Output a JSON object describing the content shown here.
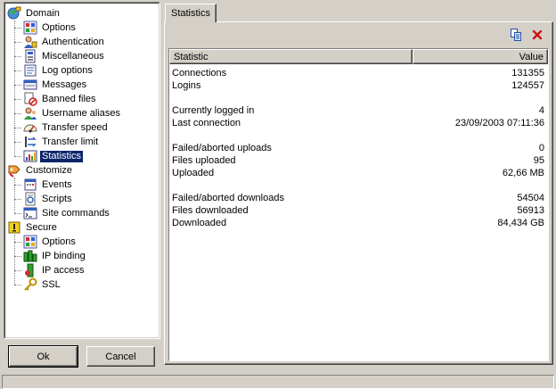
{
  "tree": {
    "items": [
      {
        "label": "Domain",
        "icon": "domain-icon",
        "level": 0
      },
      {
        "label": "Options",
        "icon": "options-icon",
        "level": 1
      },
      {
        "label": "Authentication",
        "icon": "authentication-icon",
        "level": 1
      },
      {
        "label": "Miscellaneous",
        "icon": "miscellaneous-icon",
        "level": 1
      },
      {
        "label": "Log options",
        "icon": "log-options-icon",
        "level": 1
      },
      {
        "label": "Messages",
        "icon": "messages-icon",
        "level": 1
      },
      {
        "label": "Banned files",
        "icon": "banned-files-icon",
        "level": 1
      },
      {
        "label": "Username aliases",
        "icon": "username-aliases-icon",
        "level": 1
      },
      {
        "label": "Transfer speed",
        "icon": "transfer-speed-icon",
        "level": 1
      },
      {
        "label": "Transfer limit",
        "icon": "transfer-limit-icon",
        "level": 1
      },
      {
        "label": "Statistics",
        "icon": "statistics-icon",
        "level": 1,
        "selected": true
      },
      {
        "label": "Customize",
        "icon": "customize-icon",
        "level": 0
      },
      {
        "label": "Events",
        "icon": "events-icon",
        "level": 1
      },
      {
        "label": "Scripts",
        "icon": "scripts-icon",
        "level": 1
      },
      {
        "label": "Site commands",
        "icon": "site-commands-icon",
        "level": 1
      },
      {
        "label": "Secure",
        "icon": "secure-icon",
        "level": 0
      },
      {
        "label": "Options",
        "icon": "options-icon",
        "level": 1
      },
      {
        "label": "IP binding",
        "icon": "ip-binding-icon",
        "level": 1
      },
      {
        "label": "IP access",
        "icon": "ip-access-icon",
        "level": 1
      },
      {
        "label": "SSL",
        "icon": "ssl-icon",
        "level": 1
      }
    ]
  },
  "buttons": {
    "ok": "Ok",
    "cancel": "Cancel"
  },
  "tab": {
    "label": "Statistics"
  },
  "toolbar": {
    "copy_icon": "copy-icon",
    "clear_icon": "clear-icon"
  },
  "table": {
    "headers": {
      "statistic": "Statistic",
      "value": "Value"
    },
    "groups": [
      [
        {
          "key": "Connections",
          "value": "131355"
        },
        {
          "key": "Logins",
          "value": "124557"
        }
      ],
      [
        {
          "key": "Currently logged in",
          "value": "4"
        },
        {
          "key": "Last connection",
          "value": "23/09/2003 07:11:36"
        }
      ],
      [
        {
          "key": "Failed/aborted uploads",
          "value": "0"
        },
        {
          "key": "Files uploaded",
          "value": "95"
        },
        {
          "key": "Uploaded",
          "value": "62,66 MB"
        }
      ],
      [
        {
          "key": "Failed/aborted downloads",
          "value": "54504"
        },
        {
          "key": "Files downloaded",
          "value": "56913"
        },
        {
          "key": "Downloaded",
          "value": "84,434 GB"
        }
      ]
    ]
  }
}
